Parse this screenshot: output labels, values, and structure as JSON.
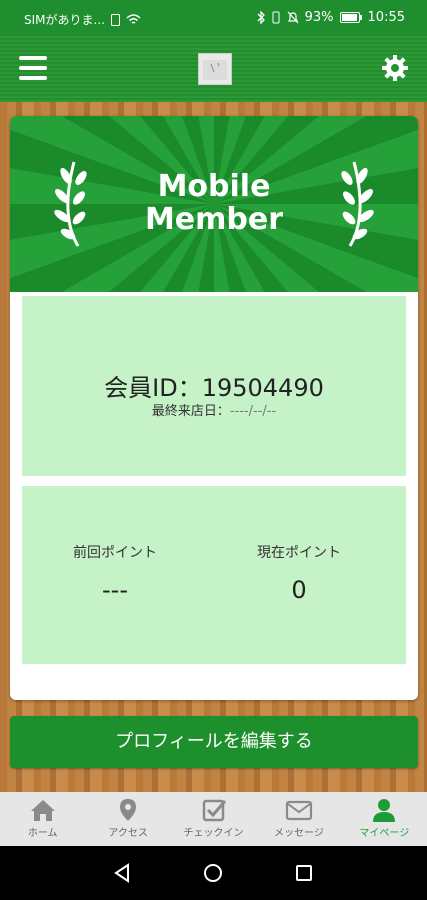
{
  "status_bar": {
    "carrier": "SIMがありま...",
    "battery": "93%",
    "time": "10:55"
  },
  "header": {
    "menu_icon": "hamburger-menu-icon",
    "settings_icon": "gear-icon"
  },
  "card": {
    "banner_title_line1": "Mobile",
    "banner_title_line2": "Member",
    "member_id_label": "会員ID：19504490",
    "last_visit_label": "最終来店日：",
    "last_visit_value": "----/--/--",
    "previous_points_label": "前回ポイント",
    "previous_points_value": "---",
    "current_points_label": "現在ポイント",
    "current_points_value": "0"
  },
  "edit_profile_button": "プロフィールを編集する",
  "tabs": [
    {
      "label": "ホーム",
      "icon": "home-icon"
    },
    {
      "label": "アクセス",
      "icon": "map-pin-icon"
    },
    {
      "label": "チェックイン",
      "icon": "checkin-icon"
    },
    {
      "label": "メッセージ",
      "icon": "mail-icon"
    },
    {
      "label": "マイページ",
      "icon": "user-icon",
      "active": true
    }
  ],
  "colors": {
    "primary_green": "#1d8f2d",
    "panel_green": "#c6f2c8",
    "active_tab": "#1d9c35"
  }
}
